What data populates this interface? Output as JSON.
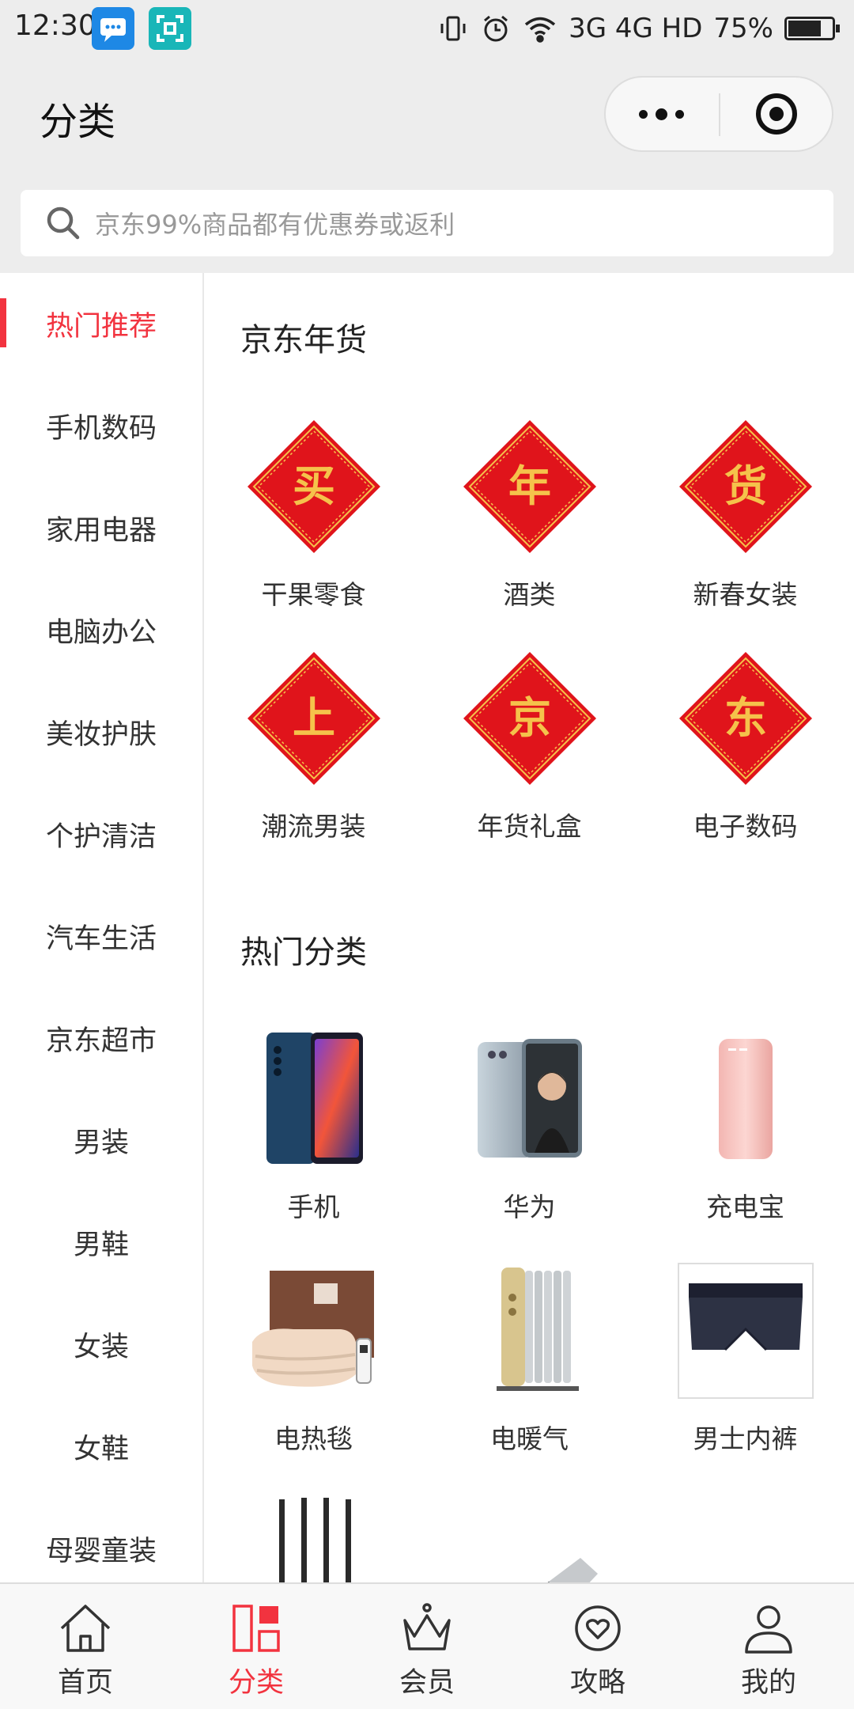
{
  "status_bar": {
    "time": "12:30",
    "network": "3G 4G HD",
    "battery": "75%",
    "battery_level": 0.75
  },
  "nav": {
    "title": "分类",
    "more_icon": "more-dots-icon",
    "close_icon": "target-close-icon"
  },
  "search": {
    "placeholder": "京东99%商品都有优惠券或返利",
    "icon": "search-icon"
  },
  "categories": [
    {
      "label": "热门推荐",
      "active": true
    },
    {
      "label": "手机数码"
    },
    {
      "label": "家用电器"
    },
    {
      "label": "电脑办公"
    },
    {
      "label": "美妆护肤"
    },
    {
      "label": "个护清洁"
    },
    {
      "label": "汽车生活"
    },
    {
      "label": "京东超市"
    },
    {
      "label": "男装"
    },
    {
      "label": "男鞋"
    },
    {
      "label": "女装"
    },
    {
      "label": "女鞋"
    },
    {
      "label": "母婴童装"
    }
  ],
  "sections": {
    "nianhuo": {
      "title": "京东年货",
      "items": [
        {
          "char": "买",
          "label": "干果零食"
        },
        {
          "char": "年",
          "label": "酒类"
        },
        {
          "char": "货",
          "label": "新春女装"
        },
        {
          "char": "上",
          "label": "潮流男装"
        },
        {
          "char": "京",
          "label": "年货礼盒"
        },
        {
          "char": "东",
          "label": "电子数码"
        }
      ]
    },
    "hot": {
      "title": "热门分类",
      "items": [
        {
          "label": "手机",
          "image": "phone-image"
        },
        {
          "label": "华为",
          "image": "huawei-phone-image"
        },
        {
          "label": "充电宝",
          "image": "power-bank-image"
        },
        {
          "label": "电热毯",
          "image": "electric-blanket-image"
        },
        {
          "label": "电暖气",
          "image": "oil-heater-image"
        },
        {
          "label": "男士内裤",
          "image": "mens-underwear-image"
        },
        {
          "label": "",
          "image": "router-image"
        },
        {
          "label": "",
          "image": "usb-drive-image"
        },
        {
          "label": "",
          "image": "microwave-image"
        }
      ]
    }
  },
  "colors": {
    "accent": "#f2333f",
    "diamond_red": "#e0141b",
    "diamond_gold": "#f5c24b"
  },
  "tabs": [
    {
      "label": "首页",
      "icon": "home-icon"
    },
    {
      "label": "分类",
      "icon": "category-icon",
      "active": true
    },
    {
      "label": "会员",
      "icon": "crown-icon"
    },
    {
      "label": "攻略",
      "icon": "heart-guide-icon"
    },
    {
      "label": "我的",
      "icon": "user-icon"
    }
  ]
}
